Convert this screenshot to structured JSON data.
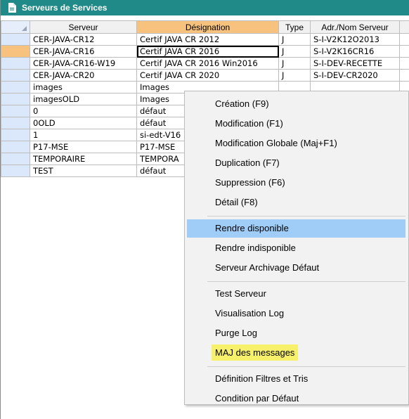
{
  "window": {
    "title": "Serveurs de Services",
    "title_bar_color": "#1f8a88"
  },
  "grid": {
    "columns": [
      "Serveur",
      "Désignation",
      "Type",
      "Adr./Nom Serveur"
    ],
    "sorted_column": "Désignation",
    "rows": [
      {
        "serveur": "CER-JAVA-CR12",
        "designation": "Certif JAVA CR 2012",
        "type": "J",
        "adr": "S-I-V2K12O2013"
      },
      {
        "serveur": "CER-JAVA-CR16",
        "designation": "Certif JAVA CR 2016",
        "type": "J",
        "adr": "S-I-V2K16CR16"
      },
      {
        "serveur": "CER-JAVA-CR16-W19",
        "designation": "Certif JAVA CR 2016 Win2016",
        "type": "J",
        "adr": "S-I-DEV-RECETTE"
      },
      {
        "serveur": "CER-JAVA-CR20",
        "designation": "Certif JAVA CR 2020",
        "type": "J",
        "adr": "S-I-DEV-CR2020"
      },
      {
        "serveur": "images",
        "designation": "Images",
        "type": "",
        "adr": ""
      },
      {
        "serveur": "imagesOLD",
        "designation": "Images",
        "type": "",
        "adr": ""
      },
      {
        "serveur": "0",
        "designation": "défaut",
        "type": "",
        "adr": ""
      },
      {
        "serveur": "0OLD",
        "designation": "défaut",
        "type": "",
        "adr": ""
      },
      {
        "serveur": "1",
        "designation": "si-edt-V16",
        "type": "",
        "adr": ""
      },
      {
        "serveur": "P17-MSE",
        "designation": "P17-MSE",
        "type": "",
        "adr": ""
      },
      {
        "serveur": "TEMPORAIRE",
        "designation": "TEMPORA",
        "type": "",
        "adr": ""
      },
      {
        "serveur": "TEST",
        "designation": "défaut",
        "type": "",
        "adr": ""
      }
    ]
  },
  "context_menu": {
    "groups": [
      [
        "Création (F9)",
        "Modification (F1)",
        "Modification Globale (Maj+F1)",
        "Duplication (F7)",
        "Suppression (F6)",
        "Détail (F8)"
      ],
      [
        "Rendre disponible",
        "Rendre indisponible",
        "Serveur Archivage Défaut"
      ],
      [
        "Test Serveur",
        "Visualisation Log",
        "Purge Log",
        "MAJ des messages"
      ],
      [
        "Définition Filtres et Tris",
        "Condition par Défaut"
      ]
    ],
    "hovered_item": "Rendre disponible",
    "marked_item": "MAJ des messages",
    "hover_color": "#9fcdf7",
    "marker_color": "#f7f06a"
  }
}
